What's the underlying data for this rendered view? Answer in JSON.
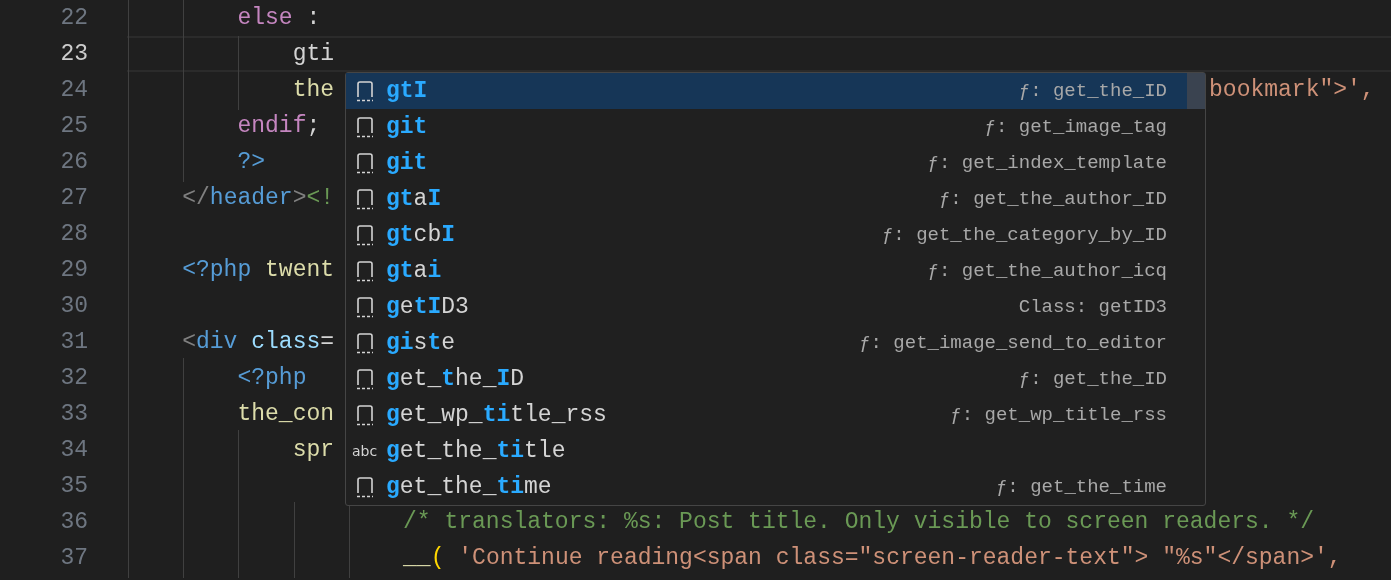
{
  "editor": {
    "lines": [
      {
        "number": "22",
        "current": false,
        "tokens": [
          {
            "kind": "keyword",
            "text": "        else"
          },
          {
            "kind": "plain",
            "text": " :"
          }
        ]
      },
      {
        "number": "23",
        "current": true,
        "tokens": [
          {
            "kind": "plain",
            "text": "            gti"
          }
        ]
      },
      {
        "number": "24",
        "current": false,
        "tokens": [
          {
            "kind": "function",
            "text": "            the"
          }
        ],
        "tail": [
          {
            "kind": "string",
            "text": "bookmark\">',"
          }
        ]
      },
      {
        "number": "25",
        "current": false,
        "tokens": [
          {
            "kind": "keyword",
            "text": "        endif"
          },
          {
            "kind": "plain",
            "text": ";"
          }
        ]
      },
      {
        "number": "26",
        "current": false,
        "tokens": [
          {
            "kind": "tag",
            "text": "        ?>"
          }
        ]
      },
      {
        "number": "27",
        "current": false,
        "tokens": [
          {
            "kind": "punct",
            "text": "    </"
          },
          {
            "kind": "tag",
            "text": "header"
          },
          {
            "kind": "punct",
            "text": ">"
          },
          {
            "kind": "comment",
            "text": "<!"
          }
        ]
      },
      {
        "number": "28",
        "current": false
      },
      {
        "number": "29",
        "current": false,
        "tokens": [
          {
            "kind": "tag",
            "text": "    <?php"
          },
          {
            "kind": "function",
            "text": " twent"
          }
        ]
      },
      {
        "number": "30",
        "current": false
      },
      {
        "number": "31",
        "current": false,
        "tokens": [
          {
            "kind": "punct",
            "text": "    <"
          },
          {
            "kind": "tag",
            "text": "div"
          },
          {
            "kind": "attribute",
            "text": " class"
          },
          {
            "kind": "plain",
            "text": "="
          }
        ]
      },
      {
        "number": "32",
        "current": false,
        "tokens": [
          {
            "kind": "tag",
            "text": "        <?php"
          }
        ]
      },
      {
        "number": "33",
        "current": false,
        "tokens": [
          {
            "kind": "function",
            "text": "        the_con"
          }
        ]
      },
      {
        "number": "34",
        "current": false,
        "tokens": [
          {
            "kind": "function",
            "text": "            spr"
          }
        ]
      },
      {
        "number": "35",
        "current": false
      },
      {
        "number": "36",
        "current": false,
        "tokens": [
          {
            "kind": "comment",
            "text": "                    /* translators: %s: Post title. Only visible to screen readers. */"
          }
        ]
      },
      {
        "number": "37",
        "current": false,
        "tokens": [
          {
            "kind": "function",
            "text": "                    __"
          },
          {
            "kind": "bracket",
            "text": "("
          },
          {
            "kind": "string",
            "text": " 'Continue reading<span class=\"screen-reader-text\"> \"%s\"</span>',"
          }
        ]
      }
    ]
  },
  "suggestions": [
    {
      "kind": "function",
      "label": "**gtI**",
      "detail": "ƒ: get_the_ID",
      "selected": true
    },
    {
      "kind": "function",
      "label": "**git**",
      "detail": "ƒ: get_image_tag",
      "selected": false
    },
    {
      "kind": "function",
      "label": "**git**",
      "detail": "ƒ: get_index_template",
      "selected": false
    },
    {
      "kind": "function",
      "label": "**gt**a**I**",
      "detail": "ƒ: get_the_author_ID",
      "selected": false
    },
    {
      "kind": "function",
      "label": "**gt**cb**I**",
      "detail": "ƒ: get_the_category_by_ID",
      "selected": false
    },
    {
      "kind": "function",
      "label": "**gt**a**i**",
      "detail": "ƒ: get_the_author_icq",
      "selected": false
    },
    {
      "kind": "function",
      "label": "**g**e**tI**D3",
      "detail": "Class: getID3",
      "selected": false
    },
    {
      "kind": "function",
      "label": "**gi**s**t**e",
      "detail": "ƒ: get_image_send_to_editor",
      "selected": false
    },
    {
      "kind": "function",
      "label": "**g**et_**t**he_**I**D",
      "detail": "ƒ: get_the_ID",
      "selected": false
    },
    {
      "kind": "function",
      "label": "**g**et_wp_**ti**tle_rss",
      "detail": "ƒ: get_wp_title_rss",
      "selected": false
    },
    {
      "kind": "word",
      "icon_text": "abc",
      "label": "**g**et_the_**ti**tle",
      "selected": false
    },
    {
      "kind": "function",
      "label": "**g**et_the_**ti**me",
      "detail": "ƒ: get_the_time",
      "selected": false
    }
  ]
}
